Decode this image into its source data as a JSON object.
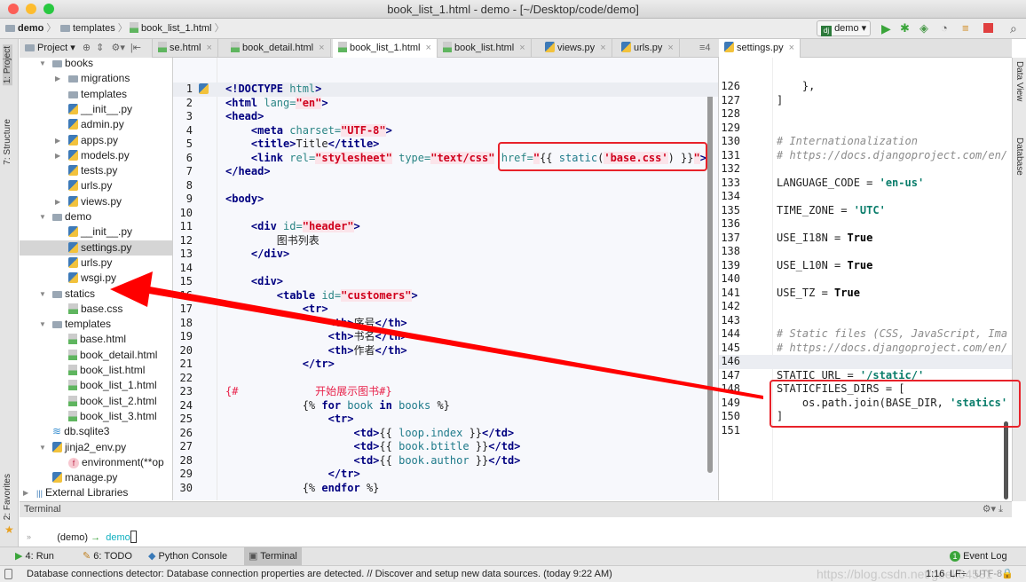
{
  "window": {
    "title": "book_list_1.html - demo - [~/Desktop/code/demo]"
  },
  "breadcrumb": [
    "demo",
    "templates",
    "book_list_1.html"
  ],
  "run_config": "demo",
  "project_toolbar": {
    "label": "Project"
  },
  "tabs": [
    {
      "label": "se.html",
      "icon": "html-file-icon"
    },
    {
      "label": "book_detail.html",
      "icon": "html-file-icon"
    },
    {
      "label": "book_list_1.html",
      "icon": "html-file-icon",
      "active": true
    },
    {
      "label": "book_list.html",
      "icon": "html-file-icon"
    },
    {
      "label": "views.py",
      "icon": "python-file-icon"
    },
    {
      "label": "urls.py",
      "icon": "python-file-icon"
    }
  ],
  "tab_overflow": "≡4",
  "right_tab": {
    "label": "settings.py"
  },
  "left_tools": [
    "1: Project",
    "7: Structure",
    "2: Favorites"
  ],
  "right_tools": [
    "Data View",
    "Database"
  ],
  "tree": [
    {
      "label": "books",
      "icon": "folder",
      "depth": 0,
      "arrow": "open"
    },
    {
      "label": "migrations",
      "icon": "folder",
      "depth": 1,
      "arrow": "closed"
    },
    {
      "label": "templates",
      "icon": "folder",
      "depth": 1
    },
    {
      "label": "__init__.py",
      "icon": "py",
      "depth": 1
    },
    {
      "label": "admin.py",
      "icon": "py",
      "depth": 1
    },
    {
      "label": "apps.py",
      "icon": "py",
      "depth": 1,
      "arrow": "closed"
    },
    {
      "label": "models.py",
      "icon": "py",
      "depth": 1,
      "arrow": "closed"
    },
    {
      "label": "tests.py",
      "icon": "py",
      "depth": 1
    },
    {
      "label": "urls.py",
      "icon": "py",
      "depth": 1
    },
    {
      "label": "views.py",
      "icon": "py",
      "depth": 1,
      "arrow": "closed"
    },
    {
      "label": "demo",
      "icon": "folder",
      "depth": 0,
      "arrow": "open"
    },
    {
      "label": "__init__.py",
      "icon": "py",
      "depth": 1
    },
    {
      "label": "settings.py",
      "icon": "py",
      "depth": 1,
      "selected": true
    },
    {
      "label": "urls.py",
      "icon": "py",
      "depth": 1
    },
    {
      "label": "wsgi.py",
      "icon": "py",
      "depth": 1
    },
    {
      "label": "statics",
      "icon": "folder",
      "depth": 0,
      "arrow": "open"
    },
    {
      "label": "base.css",
      "icon": "css",
      "depth": 1
    },
    {
      "label": "templates",
      "icon": "folder",
      "depth": 0,
      "arrow": "open"
    },
    {
      "label": "base.html",
      "icon": "html",
      "depth": 1
    },
    {
      "label": "book_detail.html",
      "icon": "html",
      "depth": 1
    },
    {
      "label": "book_list.html",
      "icon": "html",
      "depth": 1
    },
    {
      "label": "book_list_1.html",
      "icon": "html",
      "depth": 1
    },
    {
      "label": "book_list_2.html",
      "icon": "html",
      "depth": 1
    },
    {
      "label": "book_list_3.html",
      "icon": "html",
      "depth": 1
    },
    {
      "label": "db.sqlite3",
      "icon": "db",
      "depth": 0
    },
    {
      "label": "jinja2_env.py",
      "icon": "py",
      "depth": 0,
      "arrow": "open"
    },
    {
      "label": "environment(**op",
      "icon": "func",
      "depth": 1
    },
    {
      "label": "manage.py",
      "icon": "py",
      "depth": 0
    },
    {
      "label": "External Libraries",
      "icon": "lib",
      "depth": -1,
      "arrow": "closed"
    }
  ],
  "editor_left": [
    {
      "n": 1,
      "hl": true,
      "tokens": [
        [
          "t",
          "<!DOCTYPE "
        ],
        [
          "a",
          "html"
        ],
        [
          "t",
          ">"
        ]
      ]
    },
    {
      "n": 2,
      "tokens": [
        [
          "t",
          "<html "
        ],
        [
          "a",
          "lang="
        ],
        [
          "s",
          "\"en\""
        ],
        [
          "t",
          ">"
        ]
      ]
    },
    {
      "n": 3,
      "tokens": [
        [
          "t",
          "<head>"
        ]
      ]
    },
    {
      "n": 4,
      "tokens": [
        [
          "x",
          "    "
        ],
        [
          "t",
          "<meta "
        ],
        [
          "a",
          "charset="
        ],
        [
          "s",
          "\"UTF-8\""
        ],
        [
          "t",
          ">"
        ]
      ]
    },
    {
      "n": 5,
      "tokens": [
        [
          "x",
          "    "
        ],
        [
          "t",
          "<title>"
        ],
        [
          "x",
          "Title"
        ],
        [
          "t",
          "</title>"
        ]
      ]
    },
    {
      "n": 6,
      "tokens": [
        [
          "x",
          "    "
        ],
        [
          "t",
          "<link "
        ],
        [
          "a",
          "rel="
        ],
        [
          "s",
          "\"stylesheet\""
        ],
        [
          "x",
          " "
        ],
        [
          "a",
          "type="
        ],
        [
          "s",
          "\"text/css\""
        ],
        [
          "x",
          " "
        ],
        [
          "a",
          "href="
        ],
        [
          "s",
          "\""
        ],
        [
          "x",
          "{{ "
        ],
        [
          "v",
          "static"
        ],
        [
          "x",
          "("
        ],
        [
          "s",
          "'base.css'"
        ],
        [
          "x",
          ") }}"
        ],
        [
          "s",
          "\""
        ],
        [
          "t",
          ">"
        ]
      ]
    },
    {
      "n": 7,
      "tokens": [
        [
          "t",
          "</head>"
        ]
      ]
    },
    {
      "n": 8,
      "tokens": []
    },
    {
      "n": 9,
      "tokens": [
        [
          "t",
          "<body>"
        ]
      ]
    },
    {
      "n": 10,
      "tokens": []
    },
    {
      "n": 11,
      "tokens": [
        [
          "x",
          "    "
        ],
        [
          "t",
          "<div "
        ],
        [
          "a",
          "id="
        ],
        [
          "s",
          "\"header\""
        ],
        [
          "t",
          ">"
        ]
      ]
    },
    {
      "n": 12,
      "tokens": [
        [
          "x",
          "        图书列表"
        ]
      ]
    },
    {
      "n": 13,
      "tokens": [
        [
          "x",
          "    "
        ],
        [
          "t",
          "</div>"
        ]
      ]
    },
    {
      "n": 14,
      "tokens": []
    },
    {
      "n": 15,
      "tokens": [
        [
          "x",
          "    "
        ],
        [
          "t",
          "<div>"
        ]
      ]
    },
    {
      "n": 16,
      "tokens": [
        [
          "x",
          "        "
        ],
        [
          "t",
          "<table "
        ],
        [
          "a",
          "id="
        ],
        [
          "s",
          "\"customers\""
        ],
        [
          "t",
          ">"
        ]
      ]
    },
    {
      "n": 17,
      "tokens": [
        [
          "x",
          "            "
        ],
        [
          "t",
          "<tr>"
        ]
      ]
    },
    {
      "n": 18,
      "tokens": [
        [
          "x",
          "                "
        ],
        [
          "t",
          "<th>"
        ],
        [
          "x",
          "序号"
        ],
        [
          "t",
          "</th>"
        ]
      ]
    },
    {
      "n": 19,
      "tokens": [
        [
          "x",
          "                "
        ],
        [
          "t",
          "<th>"
        ],
        [
          "x",
          "书名"
        ],
        [
          "t",
          "</th>"
        ]
      ]
    },
    {
      "n": 20,
      "tokens": [
        [
          "x",
          "                "
        ],
        [
          "t",
          "<th>"
        ],
        [
          "x",
          "作者"
        ],
        [
          "t",
          "</th>"
        ]
      ]
    },
    {
      "n": 21,
      "tokens": [
        [
          "x",
          "            "
        ],
        [
          "t",
          "</tr>"
        ]
      ]
    },
    {
      "n": 22,
      "tokens": []
    },
    {
      "n": 23,
      "tokens": [
        [
          "cm",
          "{#            开始展示图书#}"
        ]
      ]
    },
    {
      "n": 24,
      "tokens": [
        [
          "x",
          "            {% "
        ],
        [
          "k",
          "for "
        ],
        [
          "v",
          "book "
        ],
        [
          "k",
          "in "
        ],
        [
          "v",
          "books"
        ],
        [
          "x",
          " %}"
        ]
      ]
    },
    {
      "n": 25,
      "tokens": [
        [
          "x",
          "                "
        ],
        [
          "t",
          "<tr>"
        ]
      ]
    },
    {
      "n": 26,
      "tokens": [
        [
          "x",
          "                    "
        ],
        [
          "t",
          "<td>"
        ],
        [
          "x",
          "{{ "
        ],
        [
          "v",
          "loop.index"
        ],
        [
          "x",
          " }}"
        ],
        [
          "t",
          "</td>"
        ]
      ]
    },
    {
      "n": 27,
      "tokens": [
        [
          "x",
          "                    "
        ],
        [
          "t",
          "<td>"
        ],
        [
          "x",
          "{{ "
        ],
        [
          "v",
          "book.btitle"
        ],
        [
          "x",
          " }}"
        ],
        [
          "t",
          "</td>"
        ]
      ]
    },
    {
      "n": 28,
      "tokens": [
        [
          "x",
          "                    "
        ],
        [
          "t",
          "<td>"
        ],
        [
          "x",
          "{{ "
        ],
        [
          "v",
          "book.author"
        ],
        [
          "x",
          " }}"
        ],
        [
          "t",
          "</td>"
        ]
      ]
    },
    {
      "n": 29,
      "tokens": [
        [
          "x",
          "                "
        ],
        [
          "t",
          "</tr>"
        ]
      ]
    },
    {
      "n": 30,
      "tokens": [
        [
          "x",
          "            {% "
        ],
        [
          "k",
          "endfor"
        ],
        [
          "x",
          " %}"
        ]
      ]
    }
  ],
  "editor_right": [
    {
      "n": 126,
      "tokens": [
        [
          "x",
          "    },"
        ]
      ]
    },
    {
      "n": 127,
      "tokens": [
        [
          "x",
          "]"
        ]
      ]
    },
    {
      "n": 128,
      "tokens": []
    },
    {
      "n": 129,
      "tokens": []
    },
    {
      "n": 130,
      "tokens": [
        [
          "pc",
          "# Internationalization"
        ]
      ]
    },
    {
      "n": 131,
      "tokens": [
        [
          "pc",
          "# https://docs.djangoproject.com/en/"
        ]
      ]
    },
    {
      "n": 132,
      "tokens": []
    },
    {
      "n": 133,
      "tokens": [
        [
          "x",
          "LANGUAGE_CODE = "
        ],
        [
          "ps",
          "'en-us'"
        ]
      ]
    },
    {
      "n": 134,
      "tokens": []
    },
    {
      "n": 135,
      "tokens": [
        [
          "x",
          "TIME_ZONE = "
        ],
        [
          "ps",
          "'UTC'"
        ]
      ]
    },
    {
      "n": 136,
      "tokens": []
    },
    {
      "n": 137,
      "tokens": [
        [
          "x",
          "USE_I18N = "
        ],
        [
          "pk",
          "True"
        ]
      ]
    },
    {
      "n": 138,
      "tokens": []
    },
    {
      "n": 139,
      "tokens": [
        [
          "x",
          "USE_L10N = "
        ],
        [
          "pk",
          "True"
        ]
      ]
    },
    {
      "n": 140,
      "tokens": []
    },
    {
      "n": 141,
      "tokens": [
        [
          "x",
          "USE_TZ = "
        ],
        [
          "pk",
          "True"
        ]
      ]
    },
    {
      "n": 142,
      "tokens": []
    },
    {
      "n": 143,
      "tokens": []
    },
    {
      "n": 144,
      "tokens": [
        [
          "pc",
          "# Static files (CSS, JavaScript, Ima"
        ]
      ]
    },
    {
      "n": 145,
      "tokens": [
        [
          "pc",
          "# https://docs.djangoproject.com/en/"
        ]
      ]
    },
    {
      "n": 146,
      "hl": true,
      "tokens": []
    },
    {
      "n": 147,
      "tokens": [
        [
          "x",
          "STATIC_URL = "
        ],
        [
          "ps",
          "'/static/'"
        ]
      ]
    },
    {
      "n": 148,
      "tokens": [
        [
          "x",
          "STATICFILES_DIRS = ["
        ]
      ]
    },
    {
      "n": 149,
      "tokens": [
        [
          "x",
          "    os.path.join(BASE_DIR, "
        ],
        [
          "ps",
          "'statics'"
        ]
      ]
    },
    {
      "n": 150,
      "tokens": [
        [
          "x",
          "]"
        ]
      ]
    },
    {
      "n": 151,
      "tokens": []
    }
  ],
  "terminal": {
    "title": "Terminal",
    "prompt_env": "(demo)",
    "prompt_arrow": "→",
    "prompt_dir": "demo"
  },
  "bottom_tools": [
    {
      "label": "4: Run",
      "icon": "run-icon"
    },
    {
      "label": "6: TODO",
      "icon": "todo-icon"
    },
    {
      "label": "Python Console",
      "icon": "python-console-icon"
    },
    {
      "label": "Terminal",
      "icon": "terminal-icon",
      "active": true
    }
  ],
  "event_log": {
    "label": "Event Log",
    "count": "1"
  },
  "status": {
    "message": "Database connections detector: Database connection properties are detected. // Discover and setup new data sources. (today 9:22 AM)",
    "position": "1:16",
    "line_sep": "LF÷",
    "encoding": "UTF-8"
  },
  "watermark": "https://blog.csdn.net/geek64581",
  "colors": {
    "annotation_red": "#e8222a",
    "run_green": "#3aa53a",
    "stop_red": "#e04040"
  }
}
